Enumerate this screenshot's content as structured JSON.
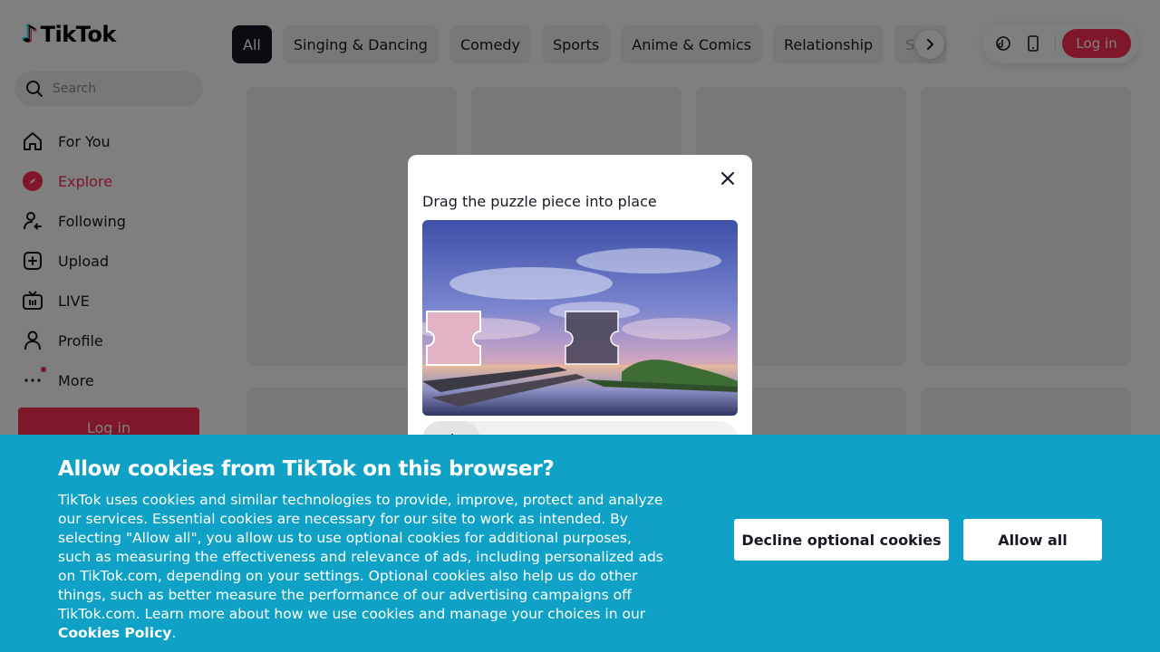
{
  "logo": {
    "glyph": "♪",
    "text": "TikTok"
  },
  "search": {
    "placeholder": "Search"
  },
  "nav": [
    {
      "label": "For You",
      "icon": "home-icon"
    },
    {
      "label": "Explore",
      "icon": "compass-icon",
      "active": true
    },
    {
      "label": "Following",
      "icon": "user-follow-icon"
    },
    {
      "label": "Upload",
      "icon": "plus-square-icon"
    },
    {
      "label": "LIVE",
      "icon": "live-tv-icon"
    },
    {
      "label": "Profile",
      "icon": "person-icon"
    },
    {
      "label": "More",
      "icon": "more-dots-icon"
    }
  ],
  "sidebar_login": "Log in",
  "categories": [
    "All",
    "Singing & Dancing",
    "Comedy",
    "Sports",
    "Anime & Comics",
    "Relationship",
    "Shows"
  ],
  "top_login": "Log in",
  "captcha": {
    "title": "Drag the puzzle piece into place"
  },
  "cookie": {
    "title": "Allow cookies from TikTok on this browser?",
    "body": "TikTok uses cookies and similar technologies to provide, improve, protect and analyze our services. Essential cookies are necessary for our site to work as intended. By selecting \"Allow all\", you allow us to use optional cookies for additional purposes, such as measuring the effectiveness and relevance of ads, including personalized ads on TikTok.com, depending on your settings. Optional cookies also help us do other things, such as better measure the performance of our advertising campaigns off TikTok.com. Learn more about how we use cookies and manage your choices in our",
    "link": "Cookies Policy",
    "end": ".",
    "decline": "Decline optional cookies",
    "allow": "Allow all"
  },
  "colors": {
    "brand": "#fe2c55",
    "banner": "#10a2c6"
  }
}
